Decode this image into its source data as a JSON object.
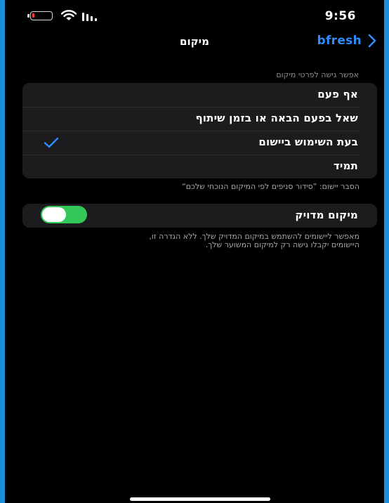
{
  "status_bar": {
    "time": "9:56",
    "battery_color": "#ff3b30",
    "wifi_icon": "wifi-icon",
    "signal_icon": "cellular-signal-icon"
  },
  "nav": {
    "title": "מיקום",
    "back_label": "bfresh",
    "accent": "#2f8cff"
  },
  "location_access": {
    "header": "אפשר גישה לפרטי מיקום",
    "options": [
      {
        "label": "אף פעם",
        "selected": false
      },
      {
        "label": "שאל בפעם הבאה או בזמן שיתוף",
        "selected": false
      },
      {
        "label": "בעת השימוש ביישום",
        "selected": true
      },
      {
        "label": "תמיד",
        "selected": false
      }
    ],
    "footer": "הסבר יישום: ”סידור סניפים לפי המיקום הנוכחי שלכם“"
  },
  "precise_location": {
    "label": "מיקום מדויק",
    "enabled": true,
    "toggle_color": "#34c759",
    "footer_line1": "מאפשר ליישומים להשתמש במיקום המדויק שלך. ללא הגדרה זו,",
    "footer_line2": "היישומים יקבלו גישה רק למיקום המשוער שלך."
  }
}
